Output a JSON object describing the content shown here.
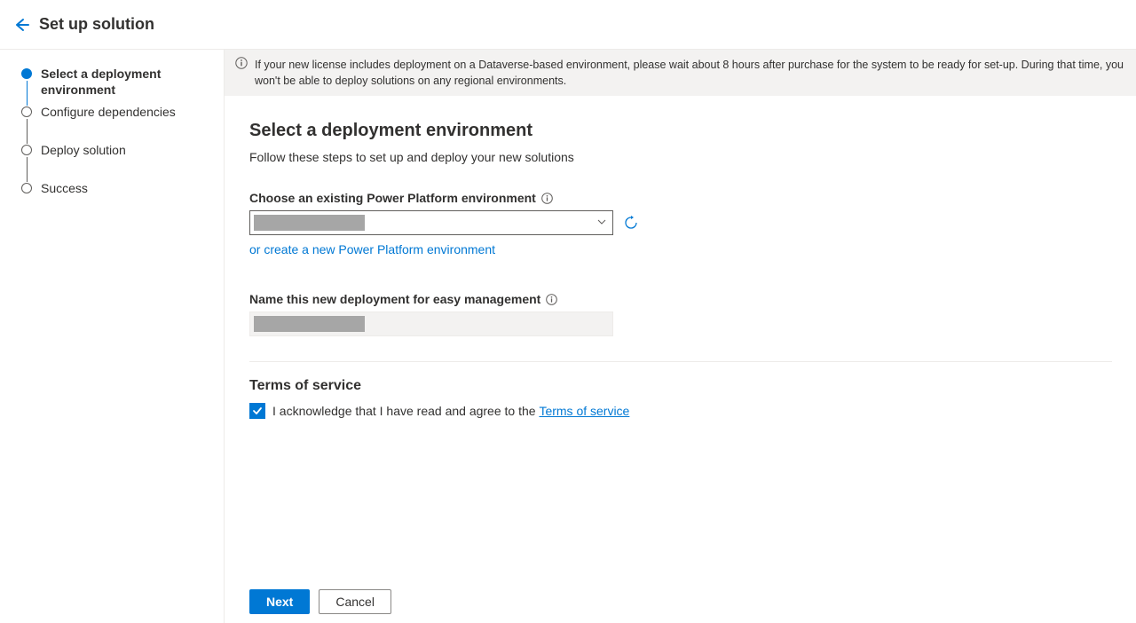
{
  "header": {
    "title": "Set up solution"
  },
  "stepper": {
    "steps": [
      {
        "label": "Select a deployment environment",
        "active": true
      },
      {
        "label": "Configure dependencies",
        "active": false
      },
      {
        "label": "Deploy solution",
        "active": false
      },
      {
        "label": "Success",
        "active": false
      }
    ]
  },
  "banner": {
    "text": "If your new license includes deployment on a Dataverse-based environment, please wait about 8 hours after purchase for the system to be ready for set-up. During that time, you won't be able to deploy solutions on any regional environments."
  },
  "main": {
    "heading": "Select a deployment environment",
    "subheading": "Follow these steps to set up and deploy your new solutions",
    "environment_field_label": "Choose an existing Power Platform environment",
    "create_link": "or create a new Power Platform environment",
    "name_field_label": "Name this new deployment for easy management",
    "tos_heading": "Terms of service",
    "tos_prefix": "I acknowledge that I have read and agree to the ",
    "tos_link": "Terms of service",
    "tos_checked": true
  },
  "footer": {
    "next_label": "Next",
    "cancel_label": "Cancel"
  },
  "colors": {
    "accent": "#0078d4"
  }
}
